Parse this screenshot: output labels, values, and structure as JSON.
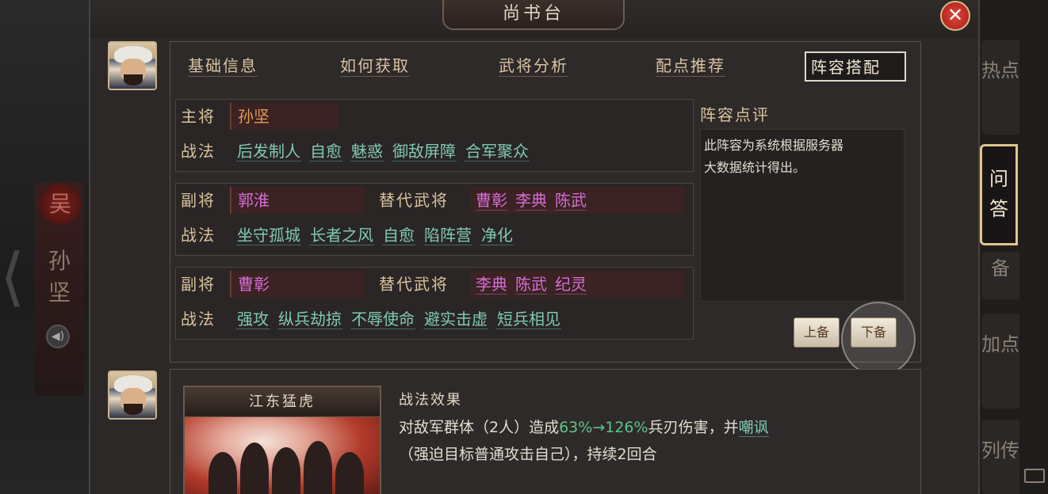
{
  "window": {
    "title": "尚书台",
    "close_label": "✕"
  },
  "background": {
    "seal": "吴",
    "name_line1": "孙",
    "name_line2": "坚",
    "voice": "◀)"
  },
  "tabs": [
    "基础信息",
    "如何获取",
    "武将分析",
    "配点推荐",
    "阵容搭配"
  ],
  "active_tab": "阵容搭配",
  "lineup": {
    "main": {
      "role": "主将",
      "name": "孙坚",
      "skills_label": "战法",
      "skills": [
        "后发制人",
        "自愈",
        "魅惑",
        "御敌屏障",
        "合军聚众"
      ]
    },
    "vice1": {
      "role": "副将",
      "name": "郭淮",
      "alt_label": "替代武将",
      "alts": [
        "曹彰",
        "李典",
        "陈武"
      ],
      "skills_label": "战法",
      "skills": [
        "坐守孤城",
        "长者之风",
        "自愈",
        "陷阵营",
        "净化"
      ]
    },
    "vice2": {
      "role": "副将",
      "name": "曹彰",
      "alt_label": "替代武将",
      "alts": [
        "李典",
        "陈武",
        "纪灵"
      ],
      "skills_label": "战法",
      "skills": [
        "强攻",
        "纵兵劫掠",
        "不辱使命",
        "避实击虚",
        "短兵相见"
      ]
    }
  },
  "review": {
    "title": "阵容点评",
    "text_line1": "此阵容为系统根据服务器",
    "text_line2": "大数据统计得出。"
  },
  "buttons": {
    "prev": "上备",
    "next": "下备"
  },
  "skill_card": {
    "name": "江东猛虎",
    "effect_title": "战法效果",
    "effect_part1": "对敌军群体（2人）造成",
    "effect_pct": "63%→126%",
    "effect_part2": "兵刃伤害，并",
    "effect_link": "嘲讽",
    "effect_line2": "（强迫目标普通攻击自己），持续2回合"
  },
  "side_tabs": [
    {
      "label": "热点"
    },
    {
      "label": "问答"
    },
    {
      "label": "备"
    },
    {
      "label": "加点"
    },
    {
      "label": "列传"
    }
  ],
  "colors": {
    "main_general": "#e39a52",
    "vice_general": "#d86cd6",
    "skill": "#7fc9b6",
    "percent": "#5fc489"
  }
}
